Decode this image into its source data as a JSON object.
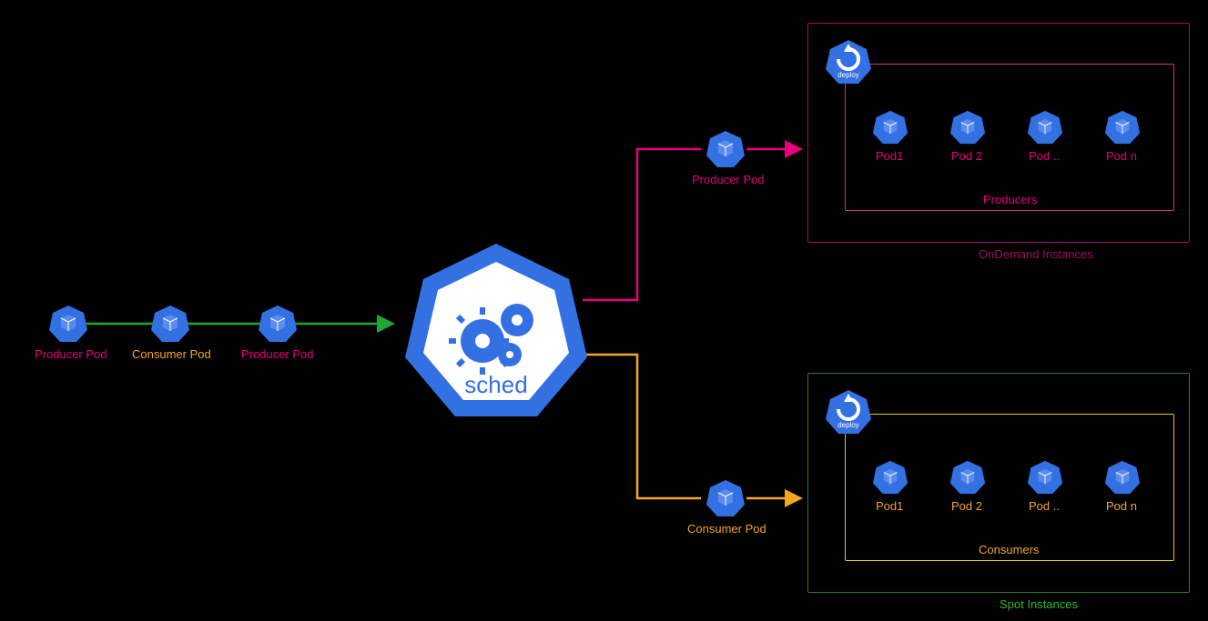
{
  "leftRow": {
    "items": [
      {
        "label": "Producer Pod",
        "color": "pink"
      },
      {
        "label": "Consumer Pod",
        "color": "orange"
      },
      {
        "label": "Producer Pod",
        "color": "pink"
      }
    ]
  },
  "scheduler": {
    "label": "sched"
  },
  "branchTop": {
    "label": "Producer Pod",
    "color": "pink"
  },
  "branchBottom": {
    "label": "Consumer Pod",
    "color": "orange"
  },
  "topGroup": {
    "outerLabel": "OnDemand Instances",
    "innerLabel": "Producers",
    "deployLabel": "deploy",
    "pods": [
      "Pod1",
      "Pod 2",
      "Pod ..",
      "Pod n"
    ],
    "podColor": "pink",
    "outerColor": "#a01060",
    "innerColor": "#d63384"
  },
  "bottomGroup": {
    "outerLabel": "Spot Instances",
    "innerLabel": "Consumers",
    "deployLabel": "deploy",
    "pods": [
      "Pod1",
      "Pod 2",
      "Pod ..",
      "Pod n"
    ],
    "podColor": "orange",
    "outerColor": "#2e7d32",
    "innerColor": "#e0d000"
  },
  "colors": {
    "k8sBlue": "#3371e3",
    "k8sBlueDark": "#2b5fc9",
    "greenLine": "#1fa82e",
    "pinkLine": "#e6007e",
    "orangeLine": "#f5a623"
  }
}
